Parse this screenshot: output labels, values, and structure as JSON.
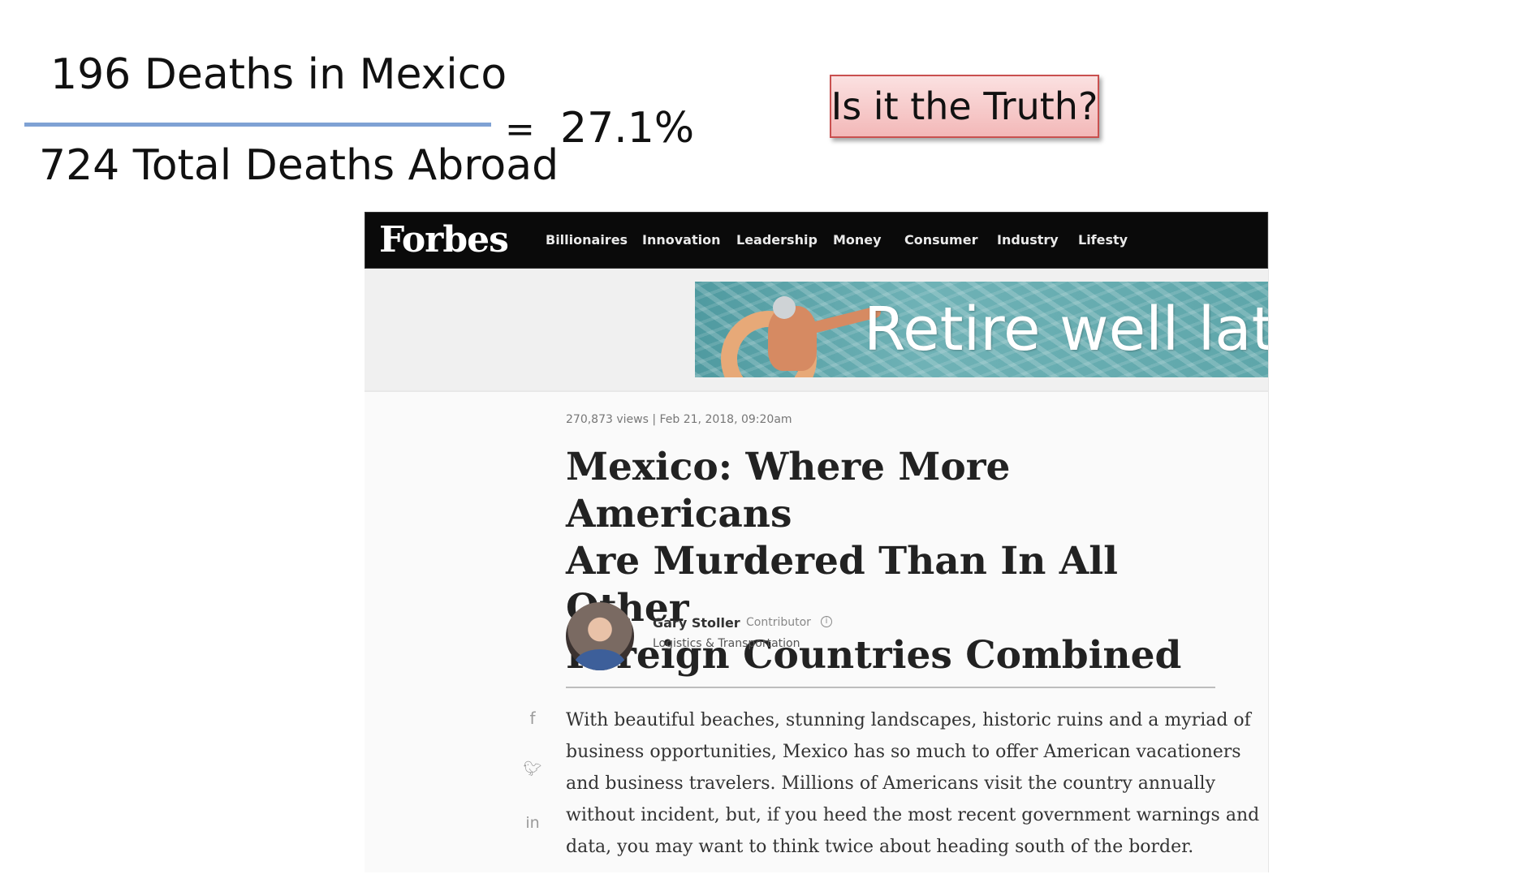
{
  "slide": {
    "numerator": "196 Deaths in Mexico",
    "denominator": "724 Total Deaths Abroad",
    "equals": "=",
    "result": "27.1%",
    "callout": "Is it the Truth?"
  },
  "forbes": {
    "logo": "Forbes",
    "nav": [
      "Billionaires",
      "Innovation",
      "Leadership",
      "Money",
      "Consumer",
      "Industry",
      "Lifesty"
    ],
    "ad_text": "Retire well late",
    "meta": "270,873 views  |  Feb 21, 2018, 09:20am",
    "headline_lines": [
      "Mexico: Where More Americans",
      "Are Murdered Than In All Other",
      "Foreign Countries Combined"
    ],
    "author": {
      "name": "Gary Stoller",
      "role": "Contributor",
      "topic": "Logistics & Transportation"
    },
    "share_icons": [
      "facebook-icon",
      "twitter-icon",
      "linkedin-icon"
    ],
    "body_lines": [
      "With beautiful beaches, stunning landscapes, historic ruins and a myriad of",
      "business opportunities, Mexico has so much to offer American vacationers",
      "and business travelers. Millions of Americans visit the country annually",
      "without incident, but, if you heed the most recent government warnings and",
      "data, you may want to think twice about heading south of the border."
    ]
  }
}
